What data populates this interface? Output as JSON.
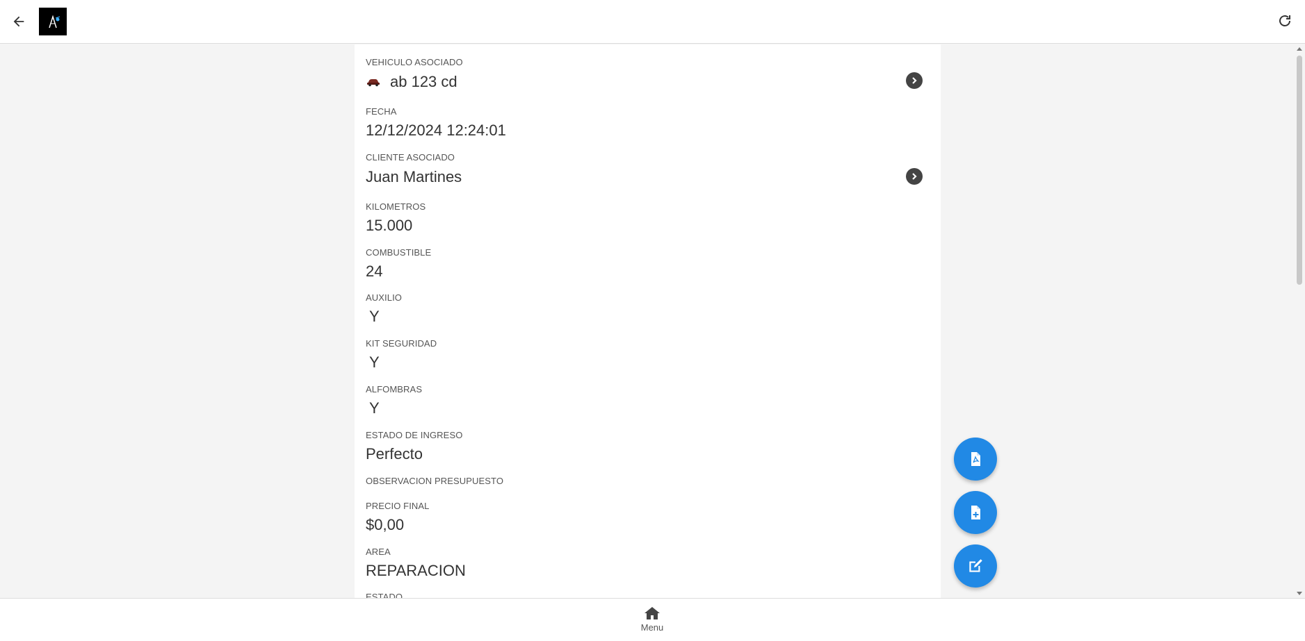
{
  "header": {
    "back_icon": "arrow-left-icon",
    "logo_icon": "app-logo",
    "refresh_icon": "refresh-icon"
  },
  "fields": {
    "vehiculo": {
      "label": "VEHICULO ASOCIADO",
      "value": "ab 123 cd",
      "icon": "car-icon"
    },
    "fecha": {
      "label": "FECHA",
      "value": "12/12/2024 12:24:01"
    },
    "cliente": {
      "label": "CLIENTE ASOCIADO",
      "value": "Juan Martines"
    },
    "kilometros": {
      "label": "KILOMETROS",
      "value": "15.000"
    },
    "combustible": {
      "label": "COMBUSTIBLE",
      "value": "24"
    },
    "auxilio": {
      "label": "AUXILIO",
      "value": "Y"
    },
    "kit": {
      "label": "KIT SEGURIDAD",
      "value": "Y"
    },
    "alfombras": {
      "label": "ALFOMBRAS",
      "value": "Y"
    },
    "estado_ingreso": {
      "label": "ESTADO DE INGRESO",
      "value": "Perfecto"
    },
    "observacion": {
      "label": "OBSERVACION PRESUPUESTO",
      "value": ""
    },
    "precio": {
      "label": "PRECIO FINAL",
      "value": "$0,00"
    },
    "area": {
      "label": "AREA",
      "value": "REPARACION"
    },
    "estado": {
      "label": "ESTADO"
    }
  },
  "fabs": [
    {
      "icon": "pdf-file-icon"
    },
    {
      "icon": "file-add-icon"
    },
    {
      "icon": "edit-icon"
    }
  ],
  "bottom_nav": {
    "menu_label": "Menu",
    "menu_icon": "home-icon"
  },
  "colors": {
    "accent": "#2189e5",
    "chevron": "#444444"
  }
}
